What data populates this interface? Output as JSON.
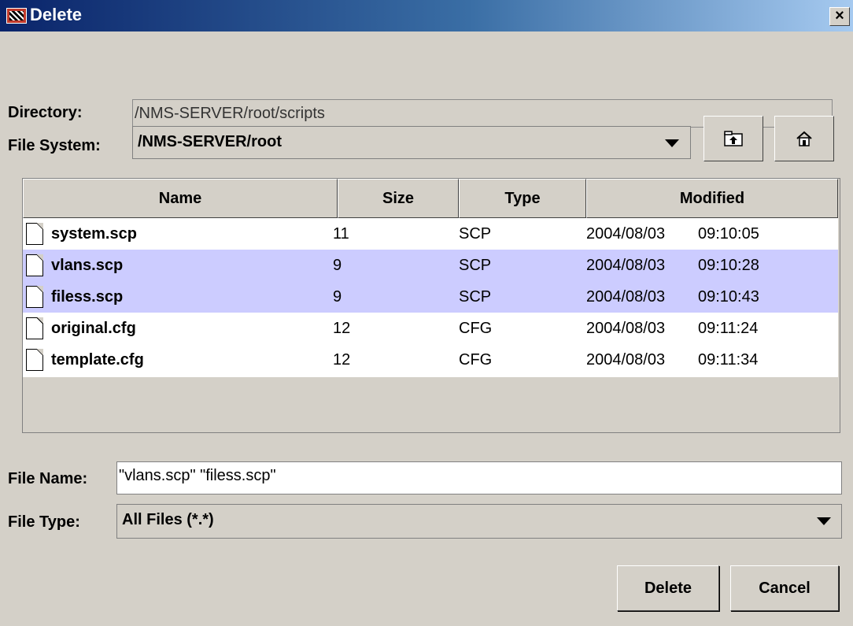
{
  "window": {
    "title": "Delete",
    "close_glyph": "×"
  },
  "directory": {
    "label": "Directory:",
    "value": "/NMS-SERVER/root/scripts"
  },
  "file_system": {
    "label": "File System:",
    "value": "/NMS-SERVER/root",
    "buttons": [
      "up-folder-icon",
      "home-icon"
    ]
  },
  "table": {
    "columns": [
      "Name",
      "Size",
      "Type",
      "Modified"
    ],
    "rows": [
      {
        "name": "system.scp",
        "size": "11",
        "type": "SCP",
        "date": "2004/08/03",
        "time": "09:10:05",
        "selected": false
      },
      {
        "name": "vlans.scp",
        "size": "9",
        "type": "SCP",
        "date": "2004/08/03",
        "time": "09:10:28",
        "selected": true
      },
      {
        "name": "filess.scp",
        "size": "9",
        "type": "SCP",
        "date": "2004/08/03",
        "time": "09:10:43",
        "selected": true
      },
      {
        "name": "original.cfg",
        "size": "12",
        "type": "CFG",
        "date": "2004/08/03",
        "time": "09:11:24",
        "selected": false
      },
      {
        "name": "template.cfg",
        "size": "12",
        "type": "CFG",
        "date": "2004/08/03",
        "time": "09:11:34",
        "selected": false
      }
    ]
  },
  "file_name": {
    "label": "File Name:",
    "value": "\"vlans.scp\" \"filess.scp\""
  },
  "file_type": {
    "label": "File Type:",
    "value": "All Files (*.*)"
  },
  "actions": {
    "delete_label": "Delete",
    "cancel_label": "Cancel"
  },
  "colors": {
    "title_gradient_start": "#0a246a",
    "selection": "#ccccff",
    "panel": "#d4d0c8"
  }
}
